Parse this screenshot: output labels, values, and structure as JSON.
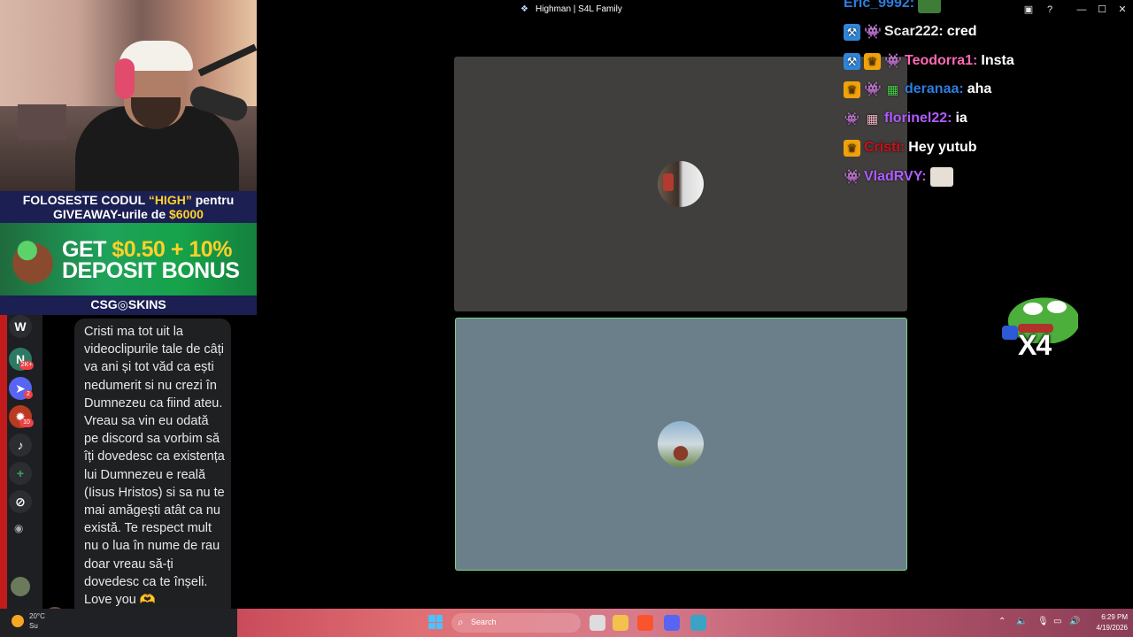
{
  "window": {
    "title": "Highman | S4L Family",
    "app_icon": "❖",
    "controls": {
      "inbox": "▣",
      "help": "?",
      "minimize": "—",
      "maximize": "☐",
      "close": "✕"
    }
  },
  "overlay_banner": {
    "line1_pre": "FOLOSESTE CODUL ",
    "line1_code": "“HIGH”",
    "line1_post": " pentru",
    "line2_pre": "GIVEAWAY-urile de ",
    "line2_amount": "$6000",
    "promo_top_pre": "GET ",
    "promo_top_amount": "$0.50 + 10%",
    "promo_bottom": "DEPOSIT BONUS",
    "brand": "CSG◎SKINS"
  },
  "server_rail": {
    "items": [
      {
        "label": "W"
      },
      {
        "label": "N",
        "badge": "2K+"
      },
      {
        "label": "➤",
        "badge": "2"
      },
      {
        "label": "✹",
        "badge": "10"
      },
      {
        "label": "♪"
      },
      {
        "label": "+"
      },
      {
        "label": "⊘"
      }
    ],
    "rss": "◉"
  },
  "chat_message": {
    "text": "Cristi ma tot uit la videoclipurile tale de câți va ani și tot văd ca ești nedumerit si nu crezi în Dumnezeu ca fiind ateu. Vreau sa vin eu odată pe discord sa vorbim să îți dovedesc ca existența lui Dumnezeu e reală (Iisus Hristos) si sa nu te mai amăgești atât ca nu există. Te respect mult nu o lua în nume de rau doar vreau să-ți dovedesc ca te înșeli. Love you 🫶"
  },
  "stream_chat": [
    {
      "user": "Eric_9992:",
      "color": "#2e7de0",
      "message": "",
      "badges": []
    },
    {
      "user": "Scar222:",
      "color": "#e8e8e8",
      "message": "cred",
      "badges": [
        "mod",
        "alien"
      ]
    },
    {
      "user": "Teodorra1:",
      "color": "#ff69b4",
      "message": "Insta",
      "badges": [
        "mod",
        "sub",
        "alien"
      ]
    },
    {
      "user": "deranaa:",
      "color": "#2e7de0",
      "message": "aha",
      "badges": [
        "sub",
        "alien",
        "gift"
      ]
    },
    {
      "user": "florinel22:",
      "color": "#b05cff",
      "message": "ia",
      "badges": [
        "pink",
        "gift"
      ]
    },
    {
      "user": "Cristi:",
      "color": "#d0101a",
      "message": "Hey yutub",
      "badges": [
        "sub"
      ]
    },
    {
      "user": "VladRVY:",
      "color": "#b05cff",
      "message": "",
      "badges": [
        "alien"
      ]
    }
  ],
  "emote": {
    "multiplier": "X4"
  },
  "taskbar": {
    "weather_temp": "20°C",
    "weather_desc": "Su",
    "search_placeholder": "Search",
    "time": "6:29 PM",
    "date": "4/19/2026"
  },
  "colors": {
    "speaking_border": "#7bd58a",
    "tile_dark": "#403f3d",
    "tile_blue": "#6b7f8b"
  }
}
